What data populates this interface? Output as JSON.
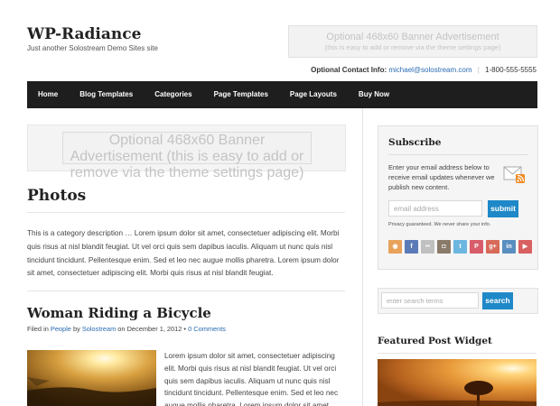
{
  "site": {
    "title": "WP-Radiance",
    "description": "Just another Solostream Demo Sites site"
  },
  "banner": {
    "line1": "Optional 468x60 Banner Advertisement",
    "line2": "(this is easy to add or remove via the theme settings page)"
  },
  "contact": {
    "label": "Optional Contact Info:",
    "email": "michael@solostream.com",
    "separator": "|",
    "phone": "1-800-555-5555"
  },
  "nav": {
    "items": [
      {
        "label": "Home"
      },
      {
        "label": "Blog Templates"
      },
      {
        "label": "Categories"
      },
      {
        "label": "Page Templates"
      },
      {
        "label": "Page Layouts"
      },
      {
        "label": "Buy Now"
      }
    ]
  },
  "content_banner": {
    "line1": "Optional 468x60 Banner Advertisement",
    "line2": "(this is easy to add or remove via the theme settings page)"
  },
  "page": {
    "title": "Photos",
    "description": "This is a category description … Lorem ipsum dolor sit amet, consectetuer adipiscing elit. Morbi quis risus at nisl blandit feugiat. Ut vel orci quis sem dapibus iaculis. Aliquam ut nunc quis nisl tincidunt tincidunt. Pellentesque enim. Sed et leo nec augue mollis pharetra. Lorem ipsum dolor sit amet, consectetuer adipiscing elit. Morbi quis risus at nisl blandit feugiat."
  },
  "post": {
    "title": "Woman Riding a Bicycle",
    "meta_filed": "Filed in",
    "meta_category": "People",
    "meta_by": "by",
    "meta_author": "Solostream",
    "meta_on": "on December 1, 2012 •",
    "meta_comments": "0 Comments",
    "excerpt": "Lorem ipsum dolor sit amet, consectetuer adipiscing elit. Morbi quis risus at nisl blandit feugiat. Ut vel orci quis sem dapibus iaculis. Aliquam ut nunc quis nisl tincidunt tincidunt. Pellentesque enim. Sed et leo nec augue mollis pharetra. Lorem ipsum dolor sit amet"
  },
  "subscribe": {
    "title": "Subscribe",
    "text": "Enter your email address below to receive email updates whenever we publish new content.",
    "placeholder": "email address",
    "button": "submit",
    "privacy": "Privacy guaranteed. We never share your info.",
    "social": [
      {
        "icon": "rss-icon",
        "glyph": "◉",
        "color": "#e8a25a"
      },
      {
        "icon": "facebook-icon",
        "glyph": "f",
        "color": "#5b7bb8"
      },
      {
        "icon": "flickr-icon",
        "glyph": "••",
        "color": "#c0c0c0"
      },
      {
        "icon": "instagram-icon",
        "glyph": "◘",
        "color": "#8a7a6a"
      },
      {
        "icon": "twitter-icon",
        "glyph": "t",
        "color": "#6cb6e0"
      },
      {
        "icon": "pinterest-icon",
        "glyph": "P",
        "color": "#d85c6a"
      },
      {
        "icon": "google-plus-icon",
        "glyph": "g+",
        "color": "#d86a5a"
      },
      {
        "icon": "linkedin-icon",
        "glyph": "in",
        "color": "#5a8ec0"
      },
      {
        "icon": "youtube-icon",
        "glyph": "▶",
        "color": "#d86060"
      }
    ]
  },
  "search": {
    "placeholder": "enter search terms",
    "button": "search"
  },
  "featured": {
    "title": "Featured Post Widget"
  }
}
